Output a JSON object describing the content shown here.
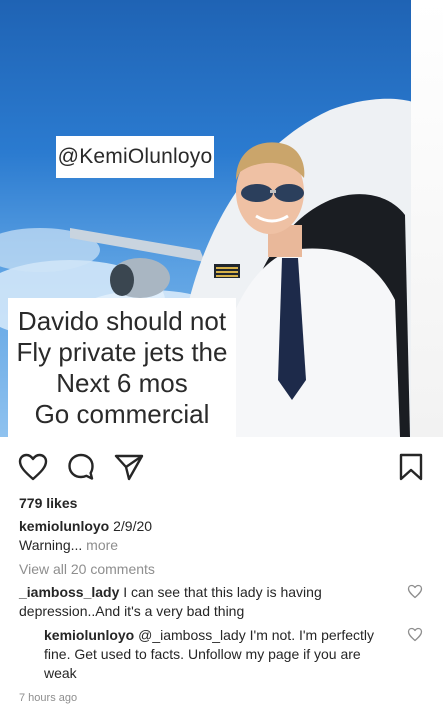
{
  "post": {
    "overlay_handle": "@KemiOlunloyo",
    "overlay_lines": [
      "Davido should not",
      "Fly private jets the",
      "Next 6 mos",
      "Go commercial"
    ]
  },
  "actions": {
    "like_icon": "heart-outline-icon",
    "comment_icon": "comment-bubble-icon",
    "share_icon": "paper-plane-icon",
    "save_icon": "bookmark-icon"
  },
  "likes": "779 likes",
  "caption": {
    "username": "kemiolunloyo",
    "date": "2/9/20",
    "text": "Warning...",
    "more": "more"
  },
  "view_all_comments": "View all 20 comments",
  "comments": [
    {
      "username": "_iamboss_lady",
      "text": "I can see that this lady is having depression..And it's a very bad thing"
    },
    {
      "username": "kemiolunloyo",
      "mention": "@_iamboss_lady",
      "text": "I'm not. I'm perfectly fine. Get used to facts. Unfollow my page if you are weak"
    }
  ],
  "timestamp": "7 hours ago"
}
